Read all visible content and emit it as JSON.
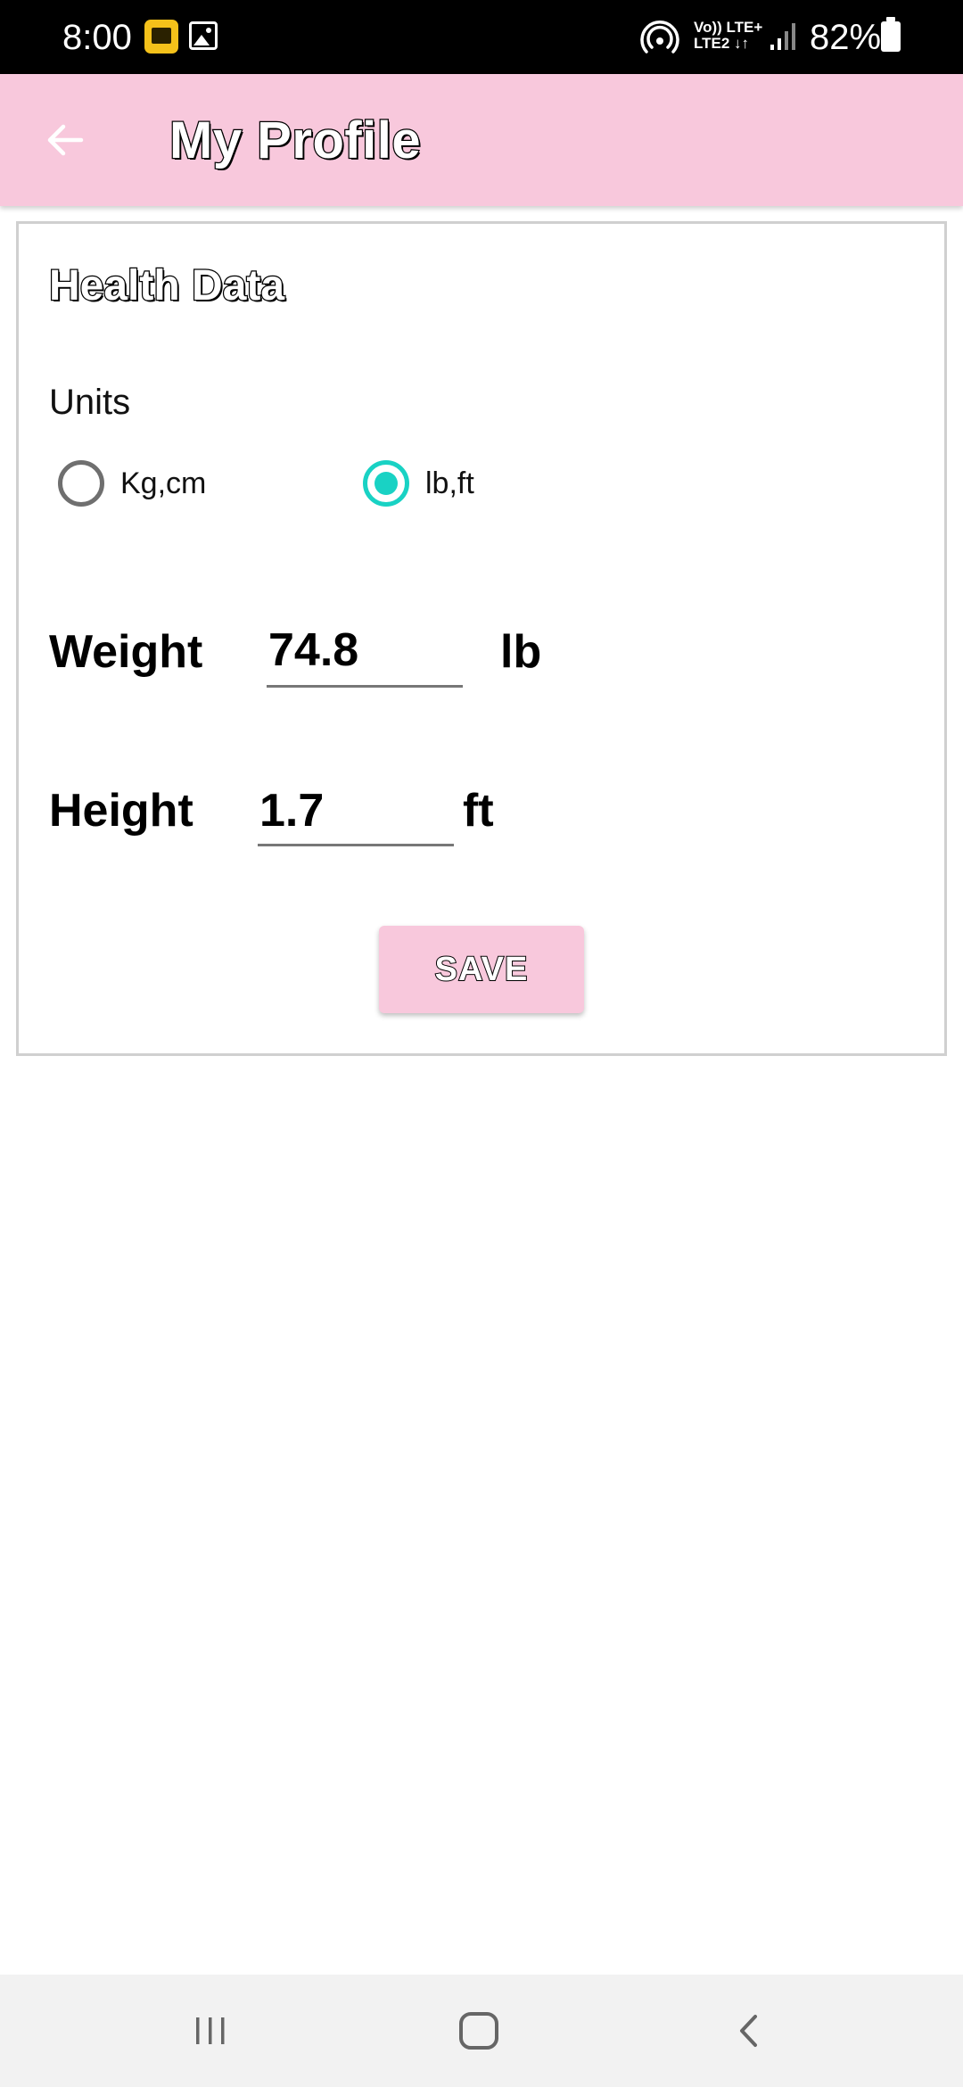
{
  "status_bar": {
    "time": "8:00",
    "network": "Vo)) LTE+\nLTE2 ↓↑",
    "battery": "82%"
  },
  "app_bar": {
    "title": "My Profile",
    "back_icon": "arrow-back-icon",
    "background_color": "#f8c8dc"
  },
  "card": {
    "title": "Health Data",
    "units_label": "Units",
    "radio_options": [
      {
        "label": "Kg,cm",
        "checked": false
      },
      {
        "label": "lb,ft",
        "checked": true
      }
    ],
    "accent_color": "#19d2c4",
    "weight": {
      "label": "Weight",
      "value": "74.8",
      "unit": "lb"
    },
    "height": {
      "label": "Height",
      "value": "1.7",
      "unit": "ft"
    },
    "save_label": "SAVE"
  },
  "nav_bar": {
    "recents_icon": "recents-icon",
    "home_icon": "home-icon",
    "back_icon": "back-icon"
  }
}
